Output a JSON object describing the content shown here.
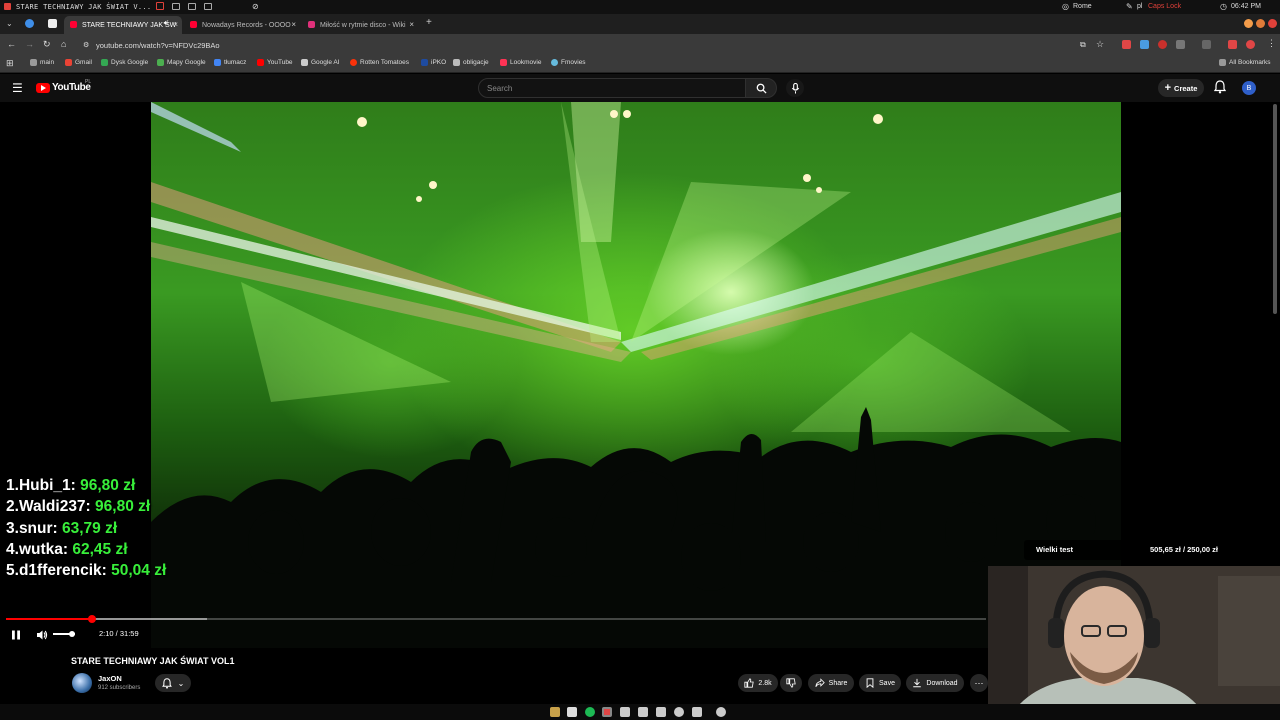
{
  "os_bar": {
    "window_title": "STARE TECHNIAWY JAK ŚWIAT V...",
    "location": "Rome",
    "keyboard": "pl",
    "caps": "Caps Lock",
    "clock": "06:42 PM"
  },
  "tabs": [
    {
      "label": "STARE TECHNIAWY JAK ŚW",
      "active": true
    },
    {
      "label": "Nowadays Records - OOOO",
      "active": false
    },
    {
      "label": "Miłość w rytmie disco - Wiki",
      "active": false
    }
  ],
  "address": {
    "url": "youtube.com/watch?v=NFDVc29BAo"
  },
  "bookmarks": [
    {
      "label": "main",
      "color": "#9a9a9a"
    },
    {
      "label": "Gmail",
      "color": "#ea4335"
    },
    {
      "label": "Dysk Google",
      "color": "#34a853"
    },
    {
      "label": "Mapy Google",
      "color": "#4caf50"
    },
    {
      "label": "tłumacz",
      "color": "#4285f4"
    },
    {
      "label": "YouTube",
      "color": "#ff0000"
    },
    {
      "label": "Google AI",
      "color": "#cccccc"
    },
    {
      "label": "Rotten Tomatoes",
      "color": "#fa320a"
    },
    {
      "label": "iPKO",
      "color": "#1e4ba0"
    },
    {
      "label": "obligacje",
      "color": "#bbbbbb"
    },
    {
      "label": "Lookmovie",
      "color": "#ff3355"
    },
    {
      "label": "Fmovies",
      "color": "#66bbdd"
    }
  ],
  "all_bookmarks": "All Bookmarks",
  "youtube": {
    "logo": "YouTube",
    "region": "PL",
    "search_placeholder": "Search",
    "create_label": "Create",
    "avatar_letter": "B"
  },
  "leaderboard": [
    {
      "rank": "1.",
      "name": "Hubi_1:",
      "amount": "96,80 zł"
    },
    {
      "rank": "2.",
      "name": "Waldi237:",
      "amount": "96,80 zł"
    },
    {
      "rank": "3.",
      "name": "snur:",
      "amount": "63,79 zł"
    },
    {
      "rank": "4.",
      "name": "wutka:",
      "amount": "62,45 zł"
    },
    {
      "rank": "5.",
      "name": "d1fferencik:",
      "amount": "50,04 zł"
    }
  ],
  "player": {
    "time": "2:10 / 31:59",
    "progress_fraction": 0.088,
    "buffer_fraction": 0.205,
    "volume_fraction": 0.85
  },
  "video": {
    "title": "STARE TECHNIAWY JAK ŚWIAT VOL1",
    "channel": "JaxON",
    "subscribers": "912 subscribers",
    "likes": "2.8k",
    "share": "Share",
    "save": "Save",
    "download": "Download"
  },
  "goal_widget": {
    "name": "Wielki test",
    "amount": "505,65 zł",
    "separator": "/",
    "target": "250,00 zł"
  },
  "colors": {
    "yt_red": "#ff0000",
    "leaderboard_amount": "#38ef3a",
    "header_bg": "#0f0f0f"
  }
}
